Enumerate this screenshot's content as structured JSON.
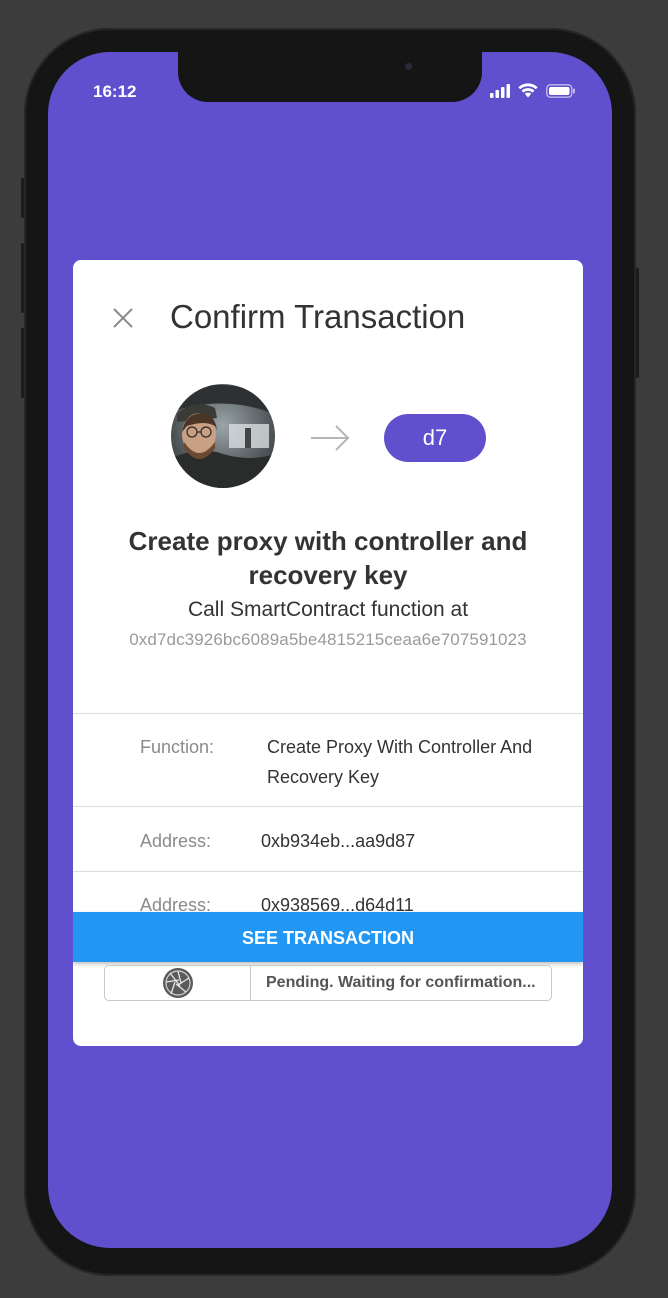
{
  "status_bar": {
    "time": "16:12"
  },
  "dialog": {
    "title": "Confirm Transaction",
    "recipient_badge": "d7",
    "heading": "Create proxy with controller and recovery key",
    "subtitle": "Call SmartContract function at",
    "contract_address": "0xd7dc3926bc6089a5be4815215ceaa6e707591023",
    "rows": [
      {
        "label": "Function:",
        "value": "Create Proxy With Controller And Recovery Key"
      },
      {
        "label": "Address:",
        "value": "0xb934eb...aa9d87"
      },
      {
        "label": "Address:",
        "value": "0x938569...d64d11"
      }
    ],
    "see_transaction_label": "SEE TRANSACTION",
    "pending_text": "Pending.  Waiting for confirmation..."
  },
  "colors": {
    "screen_bg": "#6150ce",
    "button_blue": "#2196f3",
    "badge_purple": "#6150ce"
  }
}
